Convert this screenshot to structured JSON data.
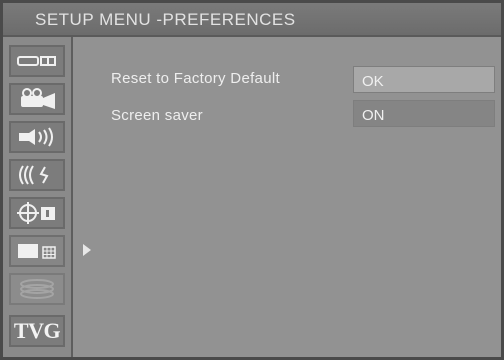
{
  "header": {
    "title": "SETUP MENU -PREFERENCES"
  },
  "sidebar": {
    "items": [
      {
        "icon": "general-setup-icon"
      },
      {
        "icon": "video-setup-icon"
      },
      {
        "icon": "speaker-setup-icon"
      },
      {
        "icon": "audio-setup-icon"
      },
      {
        "icon": "language-setup-icon"
      },
      {
        "icon": "preferences-icon",
        "active": true
      },
      {
        "icon": "disc-icon"
      },
      {
        "label": "TVG"
      }
    ]
  },
  "settings": {
    "rows": [
      {
        "label": "Reset  to Factory Default",
        "value": "OK"
      },
      {
        "label": "Screen saver",
        "value": "ON"
      }
    ]
  },
  "colors": {
    "background": "#929292",
    "highlight": "#a8a8a8",
    "text": "#eeeeee"
  }
}
